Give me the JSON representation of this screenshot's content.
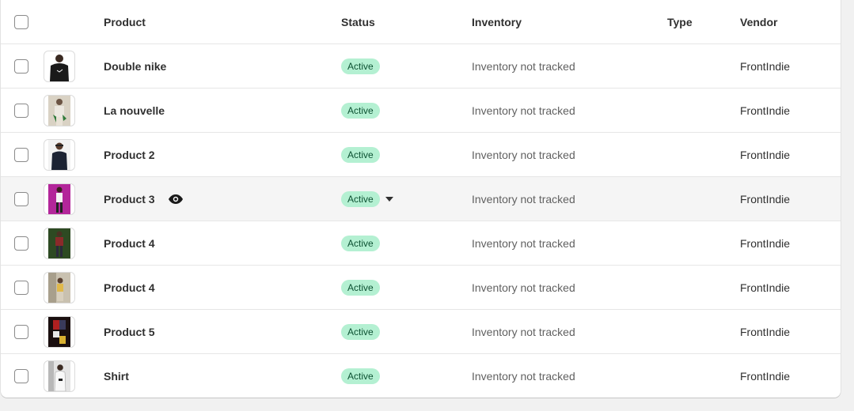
{
  "table": {
    "headers": {
      "product": "Product",
      "status": "Status",
      "inventory": "Inventory",
      "type": "Type",
      "vendor": "Vendor"
    },
    "rows": [
      {
        "title": "Double nike",
        "status": "Active",
        "inventory": "Inventory not tracked",
        "type": "",
        "vendor": "FrontIndie",
        "thumb_color": "#1a1a1a"
      },
      {
        "title": "La nouvelle",
        "status": "Active",
        "inventory": "Inventory not tracked",
        "type": "",
        "vendor": "FrontIndie",
        "thumb_color": "#d9d2c4"
      },
      {
        "title": "Product 2",
        "status": "Active",
        "inventory": "Inventory not tracked",
        "type": "",
        "vendor": "FrontIndie",
        "thumb_color": "#1c2333"
      },
      {
        "title": "Product 3",
        "status": "Active",
        "inventory": "Inventory not tracked",
        "type": "",
        "vendor": "FrontIndie",
        "thumb_color": "#b3269a"
      },
      {
        "title": "Product 4",
        "status": "Active",
        "inventory": "Inventory not tracked",
        "type": "",
        "vendor": "FrontIndie",
        "thumb_color": "#2d4a22"
      },
      {
        "title": "Product 4",
        "status": "Active",
        "inventory": "Inventory not tracked",
        "type": "",
        "vendor": "FrontIndie",
        "thumb_color": "#c9c1b0"
      },
      {
        "title": "Product 5",
        "status": "Active",
        "inventory": "Inventory not tracked",
        "type": "",
        "vendor": "FrontIndie",
        "thumb_color": "#3a1414"
      },
      {
        "title": "Shirt",
        "status": "Active",
        "inventory": "Inventory not tracked",
        "type": "",
        "vendor": "FrontIndie",
        "thumb_color": "#e4e4e4"
      }
    ]
  },
  "icons": {
    "eye": "eye-icon",
    "caret": "caret-down-icon"
  },
  "colors": {
    "badge_bg": "#b4f0d2",
    "badge_text": "#0c5132",
    "hover_row": "#f5f5f5"
  }
}
